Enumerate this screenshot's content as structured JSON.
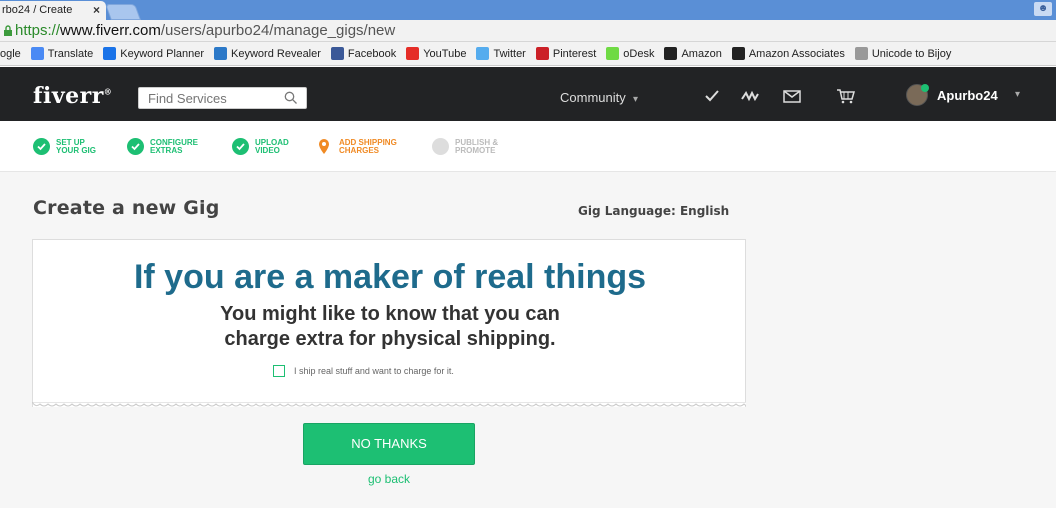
{
  "browser": {
    "tab_title": "rbo24 / Create",
    "tab_close": "×",
    "url_scheme": "https://",
    "url_host": "www.fiverr.com",
    "url_path": "/users/apurbo24/manage_gigs/new",
    "bookmarks": [
      {
        "label": "ogle",
        "icon": "google-icon",
        "color": ""
      },
      {
        "label": "Translate",
        "icon": "translate-icon",
        "color": "#4a8af4"
      },
      {
        "label": "Keyword Planner",
        "icon": "keyword-planner-icon",
        "color": "#1a73e8"
      },
      {
        "label": "Keyword Revealer",
        "icon": "keyword-revealer-icon",
        "color": "#2c79c8"
      },
      {
        "label": "Facebook",
        "icon": "facebook-icon",
        "color": "#3b5998"
      },
      {
        "label": "YouTube",
        "icon": "youtube-icon",
        "color": "#e52d27"
      },
      {
        "label": "Twitter",
        "icon": "twitter-icon",
        "color": "#55acee"
      },
      {
        "label": "Pinterest",
        "icon": "pinterest-icon",
        "color": "#cb2027"
      },
      {
        "label": "oDesk",
        "icon": "odesk-icon",
        "color": "#6fda44"
      },
      {
        "label": "Amazon",
        "icon": "amazon-icon",
        "color": "#222"
      },
      {
        "label": "Amazon Associates",
        "icon": "amazon-icon",
        "color": "#222"
      },
      {
        "label": "Unicode to Bijoy",
        "icon": "page-icon",
        "color": "#999"
      }
    ]
  },
  "header": {
    "logo": "fiverr",
    "logo_mark": "®",
    "search_placeholder": "Find Services",
    "community": "Community",
    "community_caret": "▾",
    "username": "Apurbo24",
    "user_caret": "▾"
  },
  "steps": [
    {
      "label": "SET UP\nYOUR GIG",
      "state": "done"
    },
    {
      "label": "CONFIGURE\nEXTRAS",
      "state": "done"
    },
    {
      "label": "UPLOAD\nVIDEO",
      "state": "done"
    },
    {
      "label": "ADD SHIPPING\nCHARGES",
      "state": "current"
    },
    {
      "label": "PUBLISH &\nPROMOTE",
      "state": "pending"
    }
  ],
  "main": {
    "title": "Create a new Gig",
    "language": "Gig Language: English",
    "headline": "If you are a maker of real things",
    "subline_1": "You might like to know that you can",
    "subline_2": "charge extra for physical shipping.",
    "ship_checkbox_label": "I ship real stuff and want to charge for it.",
    "no_thanks": "NO THANKS",
    "go_back": "go back"
  },
  "colors": {
    "brand_green": "#1dbf73",
    "current_orange": "#f08a24",
    "headline_blue": "#1e6b8c",
    "header_bg": "#222325"
  }
}
